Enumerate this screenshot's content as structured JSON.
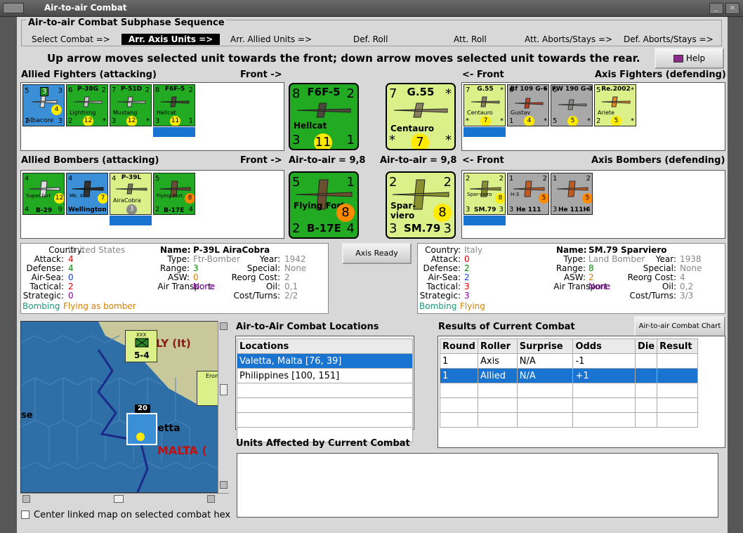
{
  "window": {
    "title": "Air-to-air Combat"
  },
  "sequence": {
    "title": "Air-to-air Combat Subphase Sequence",
    "steps": [
      "Select Combat =>",
      "Arr. Axis Units =>",
      "Arr. Allied Units =>",
      "Def. Roll",
      "Att. Roll",
      "Att. Aborts/Stays =>",
      "Def. Aborts/Stays =>"
    ],
    "active": "Arr. Axis Units =>"
  },
  "instruction": "Up arrow moves selected unit towards the front; down arrow moves selected unit towards the rear.",
  "help_label": "Help",
  "fighters": {
    "allied_label": "Allied Fighters (attacking)",
    "allied_front": "Front ->",
    "axis_front": "<- Front",
    "axis_label": "Axis Fighters (defending)",
    "allied_units": [
      {
        "name": "Albacore",
        "tl": "5",
        "tr": "3",
        "val": "4",
        "bl": "1",
        "br": "3",
        "badge": "3"
      },
      {
        "name": "Lightning",
        "title": "P-38G",
        "tl": "6",
        "tr": "2",
        "val": "12",
        "bl": "2",
        "br": "*"
      },
      {
        "name": "Mustang",
        "title": "P-51D",
        "tl": "7",
        "tr": "2",
        "val": "12",
        "bl": "3",
        "br": "*"
      },
      {
        "name": "Hellcat",
        "title": "F6F-5",
        "tl": "8",
        "tr": "2",
        "val": "11",
        "bl": "3",
        "br": "1"
      }
    ],
    "allied_big": {
      "title": "F6F-5",
      "name": "Hellcat",
      "tl": "8",
      "tr": "2",
      "val": "11",
      "bl": "3",
      "br": "1"
    },
    "axis_big": {
      "title": "G.55",
      "name": "Centauro",
      "tl": "7",
      "tr": "*",
      "val": "7",
      "bl": "*",
      "br": "*"
    },
    "axis_units": [
      {
        "name": "Centauro",
        "title": "G.55",
        "tl": "7",
        "tr": "*",
        "val": "7",
        "bl": "*",
        "br": "*"
      },
      {
        "name": "Gustav",
        "title": "Bf 109 G-6",
        "tl": "6",
        "tr": "*",
        "val": "4",
        "bl": "1",
        "br": "*"
      },
      {
        "name": "",
        "title": "FW 190 G-3",
        "tl": "6",
        "tr": "*",
        "val": "5",
        "bl": "5",
        "br": "*"
      },
      {
        "name": "Ariete",
        "title": "Re.2002",
        "tl": "5",
        "tr": "*",
        "val": "5",
        "bl": "2",
        "br": "*"
      }
    ]
  },
  "bombers": {
    "allied_label": "Allied Bombers (attacking)",
    "allied_front": "Front ->",
    "allied_ata": "Air-to-air = 9,8",
    "axis_ata": "Air-to-air = 9,8",
    "axis_front": "<- Front",
    "axis_label": "Axis Bombers (defending)",
    "allied_units": [
      {
        "name": "B-29",
        "sub": "Super fort",
        "tl": "4",
        "tr": "",
        "val": "12",
        "bl": "4",
        "br": "9"
      },
      {
        "name": "Wellington",
        "sub": "Mk. X",
        "tl": "4",
        "tr": "",
        "val": "7",
        "bl": "1",
        "br": "4"
      },
      {
        "name": "P-39L",
        "sub": "AiraCobra",
        "tl": "4",
        "tr": "",
        "val": "3",
        "bl": "",
        "br": ""
      },
      {
        "name": "B-17E",
        "sub": "Flying Fort.",
        "tl": "5",
        "tr": "",
        "val": "8",
        "bl": "2",
        "br": "4"
      }
    ],
    "allied_big": {
      "title": "",
      "name": "Flying Fort.",
      "code": "B-17E",
      "tl": "5",
      "tr": "1",
      "val": "8",
      "bl": "2",
      "br": "4"
    },
    "axis_big": {
      "name": "Spar-viero",
      "code": "SM.79",
      "tl": "2",
      "tr": "2",
      "val": "8",
      "bl": "3",
      "br": "3"
    },
    "axis_units": [
      {
        "name": "SM.79",
        "sub": "Spar-viero",
        "tl": "2",
        "tr": "2",
        "val": "8",
        "bl": "3",
        "br": "3"
      },
      {
        "name": "He 111",
        "sub": "H-3",
        "tl": "1",
        "tr": "2",
        "val": "5",
        "bl": "3",
        "br": "3"
      },
      {
        "name": "He 111H",
        "sub": "",
        "tl": "1",
        "tr": "2",
        "val": "5",
        "bl": "3",
        "br": "4"
      }
    ]
  },
  "allied_info": {
    "country_lbl": "Country:",
    "country": "United States",
    "name_lbl": "Name:",
    "name": "P-39L AiraCobra",
    "attack_lbl": "Attack:",
    "attack": "4",
    "type_lbl": "Type:",
    "type": "Ftr-Bomber",
    "year_lbl": "Year:",
    "year": "1942",
    "defense_lbl": "Defense:",
    "defense": "4",
    "range_lbl": "Range:",
    "range": "3",
    "special_lbl": "Special:",
    "special": "None",
    "airsea_lbl": "Air-Sea:",
    "airsea": "0",
    "asw_lbl": "ASW:",
    "asw": "0",
    "reorg_lbl": "Reorg Cost:",
    "reorg": "2",
    "tactical_lbl": "Tactical:",
    "tactical": "2",
    "airtransport_lbl": "Air Transport:",
    "airtransport": "None",
    "oil_lbl": "Oil:",
    "oil": "0,1",
    "strategic_lbl": "Strategic:",
    "strategic": "0",
    "cost_lbl": "Cost/Turns:",
    "cost": "2/2",
    "mode1": "Bombing",
    "mode2": "Flying as bomber"
  },
  "axis_ready_label": "Axis Ready",
  "axis_info": {
    "country_lbl": "Country:",
    "country": "Italy",
    "name_lbl": "Name:",
    "name": "SM.79 Sparviero",
    "attack_lbl": "Attack:",
    "attack": "0",
    "type_lbl": "Type:",
    "type": "Land Bomber",
    "year_lbl": "Year:",
    "year": "1938",
    "defense_lbl": "Defense:",
    "defense": "2",
    "range_lbl": "Range:",
    "range": "8",
    "special_lbl": "Special:",
    "special": "None",
    "airsea_lbl": "Air-Sea:",
    "airsea": "2",
    "asw_lbl": "ASW:",
    "asw": "2",
    "reorg_lbl": "Reorg Cost:",
    "reorg": "4",
    "tactical_lbl": "Tactical:",
    "tactical": "3",
    "airtransport_lbl": "Air Transport:",
    "airtransport": "None",
    "oil_lbl": "Oil:",
    "oil": "0,2",
    "strategic_lbl": "Strategic:",
    "strategic": "3",
    "cost_lbl": "Cost/Turns:",
    "cost": "3/3",
    "mode1": "Bombing",
    "mode2": "Flying"
  },
  "map": {
    "label_italy": "LY (It)",
    "label_valetta": "aletta",
    "label_malta": "MALTA (",
    "label_se": "se",
    "corps_top": "5-4",
    "corps_label": "XXX",
    "stack_count": "20",
    "eron": "Erone",
    "center_checkbox": "Center linked map on selected combat hex"
  },
  "locations": {
    "title": "Air-to-Air Combat Locations",
    "header": "Locations",
    "rows": [
      "Valetta, Malta [76, 39]",
      "Philippines [100, 151]",
      "",
      "",
      "",
      ""
    ],
    "selected": 0
  },
  "results": {
    "title": "Results of Current Combat",
    "chart_button": "Air-to-air Combat Chart",
    "headers": [
      "Round",
      "Roller",
      "Surprise",
      "Odds",
      "Die",
      "Result"
    ],
    "rows": [
      [
        "1",
        "Axis",
        "N/A",
        "-1",
        "",
        ""
      ],
      [
        "1",
        "Allied",
        "N/A",
        "+1",
        "",
        ""
      ],
      [
        "",
        "",
        "",
        "",
        "",
        ""
      ],
      [
        "",
        "",
        "",
        "",
        "",
        ""
      ],
      [
        "",
        "",
        "",
        "",
        "",
        ""
      ]
    ],
    "selected": 1
  },
  "affected_title": "Units Affected by Current Combat",
  "colors": {
    "active_step_bg": "#000000",
    "unit_allied": "#22aa22",
    "unit_axis": "#dcf08a",
    "selection": "#1874d0",
    "map_sea": "#2e6fa8"
  }
}
